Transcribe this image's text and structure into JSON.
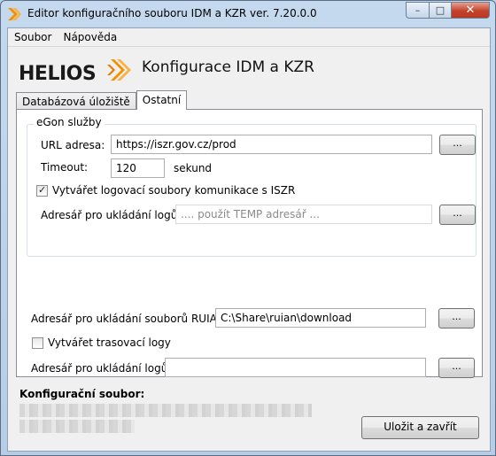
{
  "window": {
    "title": "Editor konfiguračního souboru IDM a KZR ver. 7.20.0.0",
    "min_glyph": "–",
    "max_glyph": "□",
    "close_glyph": "✕"
  },
  "menu": {
    "items": [
      {
        "label": "Soubor"
      },
      {
        "label": "Nápověda"
      }
    ]
  },
  "header": {
    "logo_text": "HELIOS",
    "title": "Konfigurace IDM a KZR",
    "logo_color": "#f39200"
  },
  "tabs": [
    {
      "label": "Databázová úložiště",
      "active": false
    },
    {
      "label": "Ostatní",
      "active": true
    }
  ],
  "egon": {
    "group_title": "eGon služby",
    "url_label": "URL adresa:",
    "url_value": "https://iszr.gov.cz/prod",
    "timeout_label": "Timeout:",
    "timeout_value": "120",
    "timeout_unit": "sekund",
    "log_checkbox_label": "Vytvářet logovací soubory komunikace s ISZR",
    "log_checked": true,
    "log_dir_label": "Adresář pro ukládání logů:",
    "log_dir_placeholder": ".... použít TEMP adresář ..."
  },
  "ruian": {
    "dir_label": "Adresář pro ukládání souborů RUIAN:",
    "dir_value": "C:\\Share\\ruian\\download"
  },
  "trace": {
    "checkbox_label": "Vytvářet trasovací logy",
    "checked": false,
    "dir_label": "Adresář pro ukládání logů:",
    "dir_value": ""
  },
  "browse_label": "...",
  "config_file_label": "Konfigurační soubor:",
  "save_button_label": "Uložit a zavřít"
}
